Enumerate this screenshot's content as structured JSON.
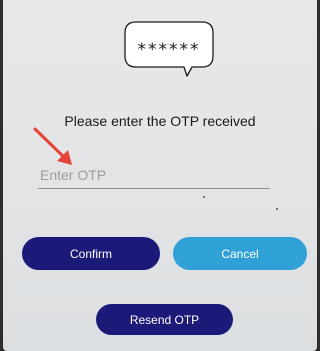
{
  "otp_bubble": {
    "masked_code": "******",
    "icon": "speech-bubble-icon"
  },
  "prompt": {
    "text": "Please enter the OTP received"
  },
  "otp_input": {
    "placeholder": "Enter OTP",
    "value": ""
  },
  "annotation": {
    "icon": "red-arrow-icon",
    "color": "#e8433a"
  },
  "buttons": {
    "confirm_label": "Confirm",
    "cancel_label": "Cancel",
    "resend_label": "Resend OTP"
  },
  "colors": {
    "primary": "#1c1a78",
    "secondary": "#2fa1d7",
    "background": "#e4e6e8"
  }
}
